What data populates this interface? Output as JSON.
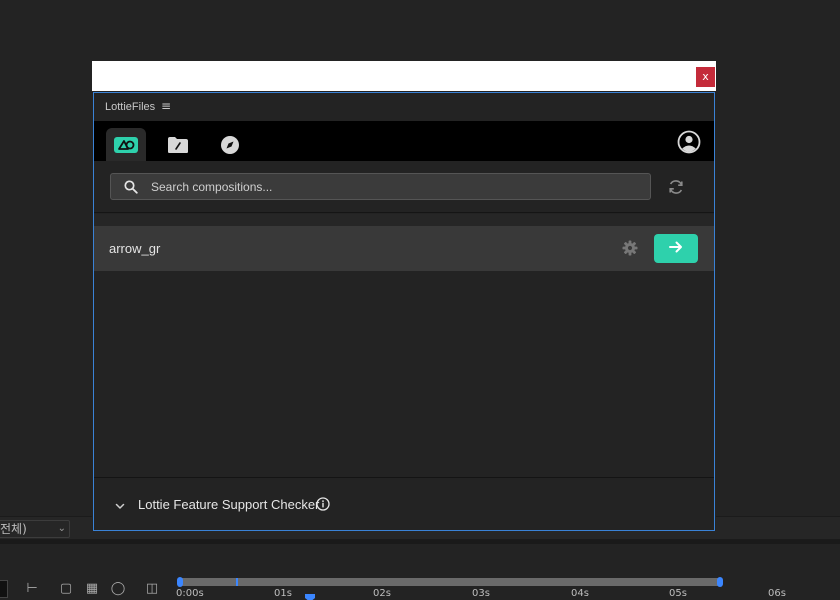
{
  "host": {
    "select_value": "전체)",
    "timeline_ticks": [
      "0:00s",
      "01s",
      "02s",
      "03s",
      "04s",
      "05s",
      "06s"
    ]
  },
  "window": {
    "close_label": "x"
  },
  "panel": {
    "title": "LottieFiles",
    "menu_icon": "hamburger-icon"
  },
  "tabs": [
    {
      "name": "tab-local",
      "icon": "lottie-local-icon",
      "active": true
    },
    {
      "name": "tab-files",
      "icon": "folder-icon",
      "active": false
    },
    {
      "name": "tab-discover",
      "icon": "compass-icon",
      "active": false
    }
  ],
  "search": {
    "placeholder": "Search compositions..."
  },
  "compositions": [
    {
      "name": "arrow_gr"
    }
  ],
  "footer": {
    "label": "Lottie Feature Support Checker"
  },
  "colors": {
    "accent": "#2ed1ac",
    "selection_border": "#3a82d6",
    "close": "#c42b3a",
    "timeline_blue": "#3b86ff"
  }
}
